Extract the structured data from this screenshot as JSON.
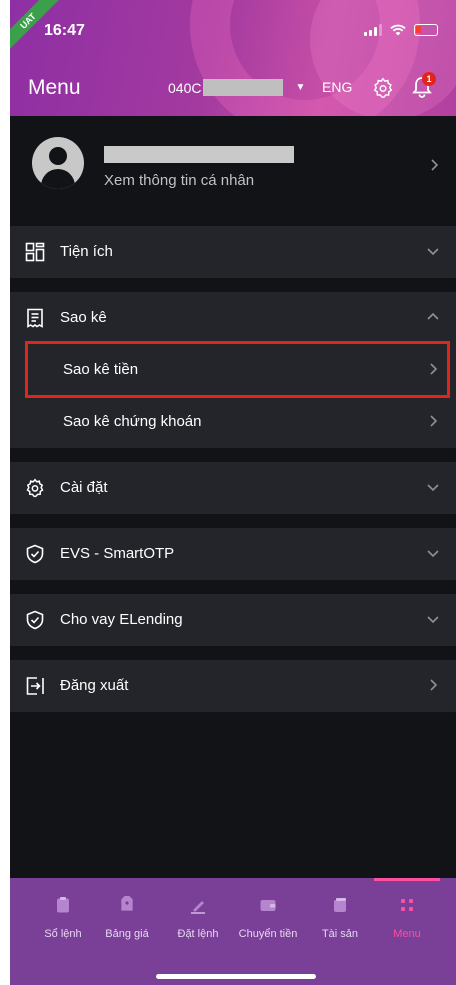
{
  "status_bar": {
    "time": "16:47",
    "env_badge": "UAT"
  },
  "header": {
    "title": "Menu",
    "account_prefix": "040C",
    "language": "ENG",
    "notification_count": "1"
  },
  "profile": {
    "subtitle": "Xem thông tin cá nhân"
  },
  "menu": {
    "tien_ich": "Tiện ích",
    "sao_ke": "Sao kê",
    "sao_ke_tien": "Sao kê tiền",
    "sao_ke_chung_khoan": "Sao kê chứng khoán",
    "cai_dat": "Cài đặt",
    "evs_smartotp": "EVS - SmartOTP",
    "cho_vay": "Cho vay ELending",
    "dang_xuat": "Đăng xuất"
  },
  "bottom_nav": {
    "items": [
      "Sổ lệnh",
      "Bảng giá",
      "Đặt lệnh",
      "Chuyển tiền",
      "Tài sản",
      "Menu"
    ],
    "active": "Menu"
  },
  "colors": {
    "header_gradient_start": "#8e2fa3",
    "header_gradient_end": "#c54ea6",
    "background": "#121316",
    "section_bg": "#23252b",
    "bottom_nav_bg": "#7a3f97",
    "active_accent": "#ff4fa0",
    "highlight_box": "#e0261b"
  }
}
